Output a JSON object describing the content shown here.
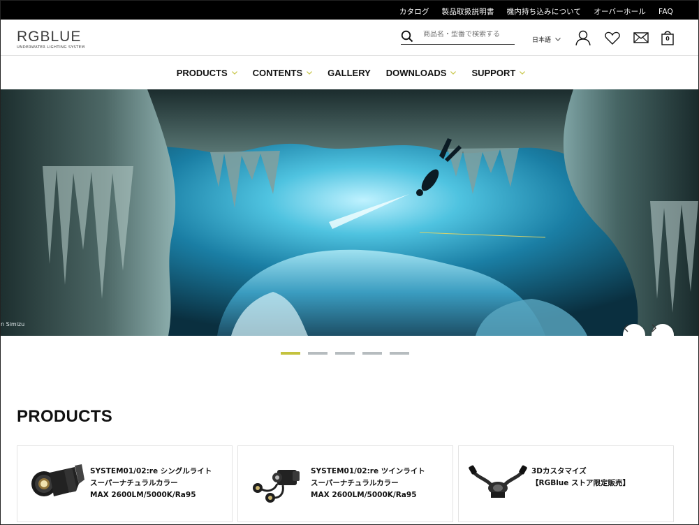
{
  "utility_nav": [
    "カタログ",
    "製品取扱説明書",
    "機内持ち込みについて",
    "オーバーホール",
    "FAQ"
  ],
  "logo": {
    "mark": "RGBLUE",
    "sub": "UNDERWATER LIGHTING SYSTEM"
  },
  "search": {
    "placeholder": "商品名・型番で検索する"
  },
  "language": {
    "selected": "日本語"
  },
  "cart": {
    "count": "0"
  },
  "main_nav": [
    {
      "label": "PRODUCTS",
      "has_dropdown": true
    },
    {
      "label": "CONTENTS",
      "has_dropdown": true
    },
    {
      "label": "GALLERY",
      "has_dropdown": false
    },
    {
      "label": "DOWNLOADS",
      "has_dropdown": true
    },
    {
      "label": "SUPPORT",
      "has_dropdown": true
    }
  ],
  "hero": {
    "photo_credit": "n Simizu",
    "slide_count": 5,
    "active_slide": 1
  },
  "products": {
    "title": "PRODUCTS",
    "items": [
      {
        "title": "SYSTEM01/02:re シングルライト\nスーパーナチュラルカラー\nMAX 2600LM/5000K/Ra95",
        "icon": "single-light"
      },
      {
        "title": "SYSTEM01/02:re ツインライト\nスーパーナチュラルカラー\nMAX 2600LM/5000K/Ra95",
        "icon": "twin-light"
      },
      {
        "title": "3Dカスタマイズ\n【RGBlue ストア限定販売】",
        "icon": "3d-arm-mount"
      }
    ]
  },
  "colors": {
    "accent": "#c4c23e",
    "topbar": "#000000",
    "dot_inactive": "#b6bcbf"
  }
}
